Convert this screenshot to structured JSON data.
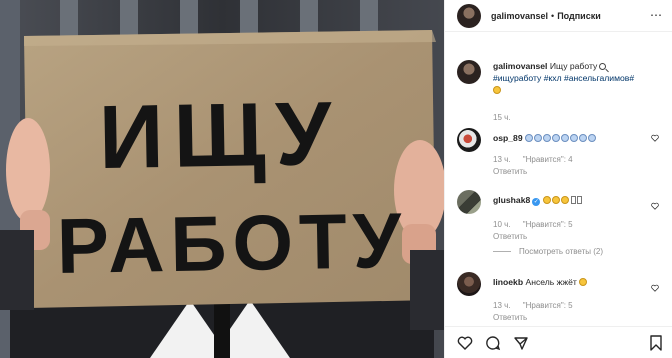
{
  "post": {
    "sign_line1": "ИЩУ",
    "sign_line2": "РАБОТУ",
    "header": {
      "username": "galimovansel",
      "separator": "•",
      "follow_label": "Подписки"
    },
    "caption": {
      "username": "galimovansel",
      "text": "Ищу работу",
      "hashtags": "#ищуработу #кхл #ансельгалимов#",
      "time": "15 ч."
    },
    "comments": [
      {
        "username": "osp_89",
        "text": "",
        "emoji_count": 8,
        "time": "13 ч.",
        "likes": "\"Нравится\": 4",
        "reply": "Ответить"
      },
      {
        "username": "glushak8",
        "text": "",
        "emoji_count": 3,
        "time": "10 ч.",
        "likes": "\"Нравится\": 5",
        "reply": "Ответить",
        "view_replies": "Посмотреть ответы (2)"
      },
      {
        "username": "linoekb",
        "text": "Ансель жжёт",
        "emoji_count": 1,
        "time": "13 ч.",
        "likes": "\"Нравится\": 5",
        "reply": "Ответить"
      }
    ]
  },
  "colors": {
    "accent": "#3897f0",
    "hashtag": "#003569",
    "secondary_text": "#8e8e8e",
    "border": "#efefef"
  }
}
